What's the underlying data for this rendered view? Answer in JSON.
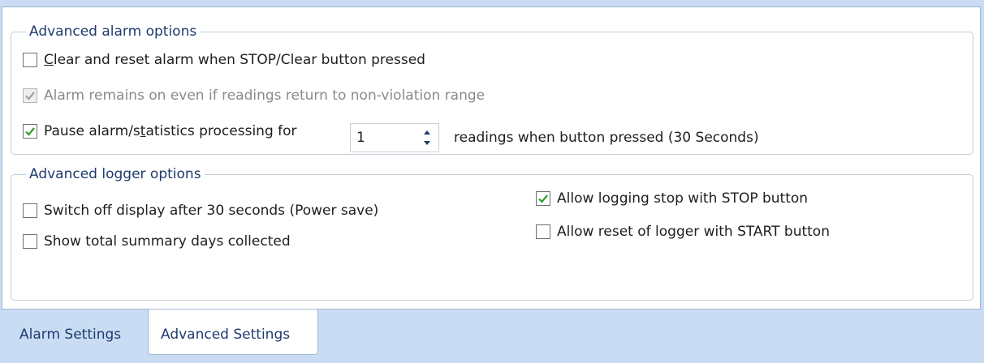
{
  "alarm_group": {
    "legend": "Advanced alarm options",
    "clear_reset": {
      "label_pre": "",
      "label_u": "C",
      "label_post": "lear and reset alarm when STOP/Clear button pressed",
      "checked": false
    },
    "alarm_remains": {
      "label": "Alarm remains on even if readings return to non-violation range",
      "checked": true,
      "disabled": true
    },
    "pause": {
      "label_pre": "Pause alarm/s",
      "label_u": "t",
      "label_post": "atistics processing for",
      "checked": true,
      "spinner_value": "1",
      "suffix": "readings when button pressed (30 Seconds)"
    }
  },
  "logger_group": {
    "legend": "Advanced logger options",
    "switch_off_display": {
      "label": "Switch off display after 30 seconds (Power save)",
      "checked": false
    },
    "show_summary": {
      "label": "Show total summary days collected",
      "checked": false
    },
    "allow_stop": {
      "label": "Allow logging stop with STOP button",
      "checked": true
    },
    "allow_reset": {
      "label": "Allow reset of logger with START button",
      "checked": false
    }
  },
  "tabs": [
    {
      "label": "Alarm Settings",
      "active": false
    },
    {
      "label": "Advanced Settings",
      "active": true
    }
  ],
  "colors": {
    "check_green": "#2e9e2e",
    "check_disabled": "#a0a0a0",
    "frame_blue": "#c9dcf3"
  }
}
